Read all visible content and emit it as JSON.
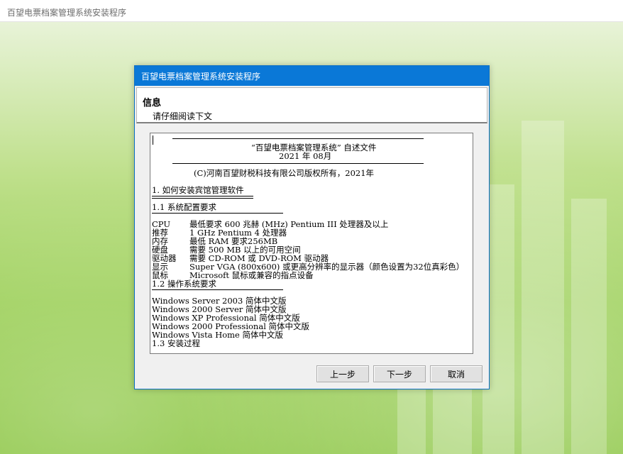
{
  "window": {
    "title": "百望电票档案管理系统安装程序"
  },
  "dialog": {
    "title": "百望电票档案管理系统安装程序",
    "header_title": "信息",
    "header_subtitle": "请仔细阅读下文",
    "doc": {
      "title": "“百望电票档案管理系统” 自述文件",
      "date": "2021 年 08月",
      "copyright": "(C)河南百望财税科技有限公司版权所有，2021年",
      "s1": "1. 如何安装宾馆管理软件",
      "s11": "1.1 系统配置要求",
      "req": [
        {
          "k": "CPU",
          "v": "最低要求 600 兆赫 (MHz) Pentium III 处理器及以上"
        },
        {
          "k": "推荐",
          "v": "1 GHz Pentium 4 处理器"
        },
        {
          "k": "内存",
          "v": "最低 RAM 要求256MB"
        },
        {
          "k": "硬盘",
          "v": "需要 500 MB 以上的可用空间"
        },
        {
          "k": "驱动器",
          "v": "需要 CD-ROM 或 DVD-ROM 驱动器"
        },
        {
          "k": "显示",
          "v": "Super VGA (800x600) 或更高分辨率的显示器（颜色设置为32位真彩色）"
        },
        {
          "k": "鼠标",
          "v": "Microsoft 鼠标或兼容的指点设备"
        }
      ],
      "s12": "1.2 操作系统要求",
      "os": [
        "Windows Server 2003 简体中文版",
        "Windows 2000 Server 简体中文版",
        "Windows XP Professional 简体中文版",
        "Windows 2000 Professional 简体中文版",
        "Windows Vista Home 简体中文版"
      ],
      "s13": "1.3 安装过程"
    },
    "buttons": {
      "prev": "上一步",
      "next": "下一步",
      "cancel": "取消"
    }
  }
}
